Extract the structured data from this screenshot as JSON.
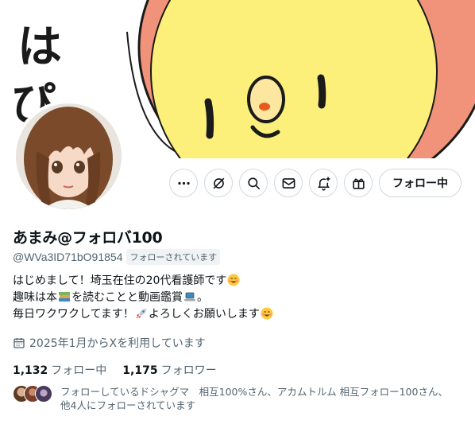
{
  "profile": {
    "display_name": "あまみ@フォロバ100",
    "handle": "@WVa3ID71bO91854",
    "follows_you_badge": "フォローされています",
    "bio": {
      "line1": "はじめまして！埼玉在住の20代看護師です",
      "line2_a": "趣味は本",
      "line2_b": "を読むことと動画鑑賞",
      "line2_c": "。",
      "line3_a": "毎日ワクワクしてます！",
      "line3_b": "よろしくお願いします"
    },
    "joined": "2025年1月からXを利用しています",
    "following_count": "1,132",
    "following_label": "フォロー中",
    "followers_count": "1,175",
    "followers_label": "フォロワー",
    "followed_by_line1": "フォローしているドシャグマ　相互100%さん、アカムトルム 相互フォロー100さん、",
    "followed_by_line2": "他4人にフォローされています"
  },
  "banner": {
    "handwritten_text": "はぴ"
  },
  "actions": {
    "more_icon": "more-icon",
    "grok_icon": "grok-icon",
    "search_icon": "search-icon",
    "message_icon": "envelope-icon",
    "notify_icon": "bell-plus-icon",
    "gift_icon": "gift-icon",
    "follow_button_label": "フォロー中"
  },
  "colors": {
    "banner_yellow": "#fdf07a",
    "banner_salmon": "#f0937a",
    "text_primary": "#0f1419",
    "text_secondary": "#536471",
    "border": "#cfd9de"
  }
}
